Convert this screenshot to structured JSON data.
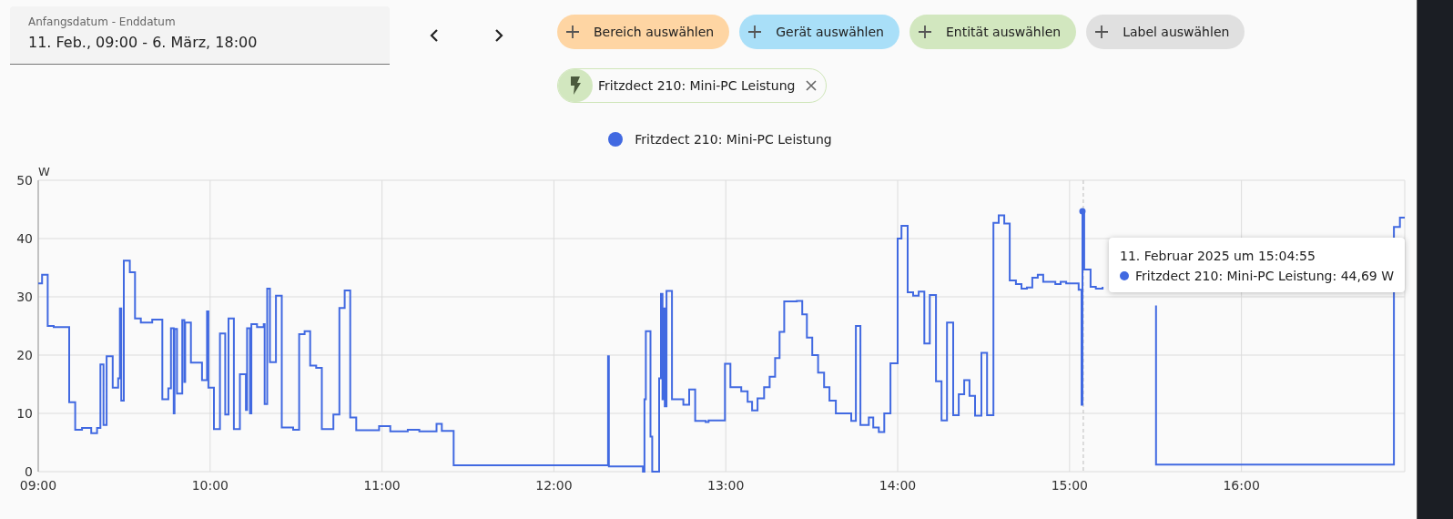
{
  "date_range": {
    "label": "Anfangsdatum - Enddatum",
    "value": "11. Feb., 09:00 - 6. März, 18:00"
  },
  "nav": [
    {
      "kind": "prev"
    },
    {
      "kind": "next"
    }
  ],
  "filters": [
    {
      "label": "Bereich auswählen",
      "color": "#fed5a3"
    },
    {
      "label": "Gerät auswählen",
      "color": "#a9dff8"
    },
    {
      "label": "Entität auswählen",
      "color": "#d2e7bf"
    },
    {
      "label": "Label auswählen",
      "color": "#e0e0e0"
    }
  ],
  "selected_entities": [
    {
      "label": "Fritzdect 210: Mini-PC Leistung",
      "kind": "power"
    }
  ],
  "chart": {
    "chart_data": {
      "type": "line",
      "grid": true,
      "ylabel": "W",
      "xlim": [
        9,
        16.95
      ],
      "ylim": [
        0,
        50
      ],
      "xticks": [
        {
          "value": 9,
          "label": "09:00"
        },
        {
          "value": 10,
          "label": "10:00"
        },
        {
          "value": 11,
          "label": "11:00"
        },
        {
          "value": 12,
          "label": "12:00"
        },
        {
          "value": 13,
          "label": "13:00"
        },
        {
          "value": 14,
          "label": "14:00"
        },
        {
          "value": 15,
          "label": "15:00"
        },
        {
          "value": 16,
          "label": "16:00"
        }
      ],
      "yticks": [
        0,
        10,
        20,
        30,
        40,
        50
      ],
      "ref_lines": [
        {
          "axis": "x",
          "value": 15.08
        }
      ],
      "x": [
        9,
        9.022,
        9.022,
        9.055,
        9.055,
        9.09,
        9.09,
        9.18,
        9.18,
        9.215,
        9.215,
        9.255,
        9.255,
        9.308,
        9.308,
        9.342,
        9.342,
        9.362,
        9.362,
        9.38,
        9.38,
        9.398,
        9.398,
        9.433,
        9.433,
        9.465,
        9.465,
        9.475,
        9.475,
        9.483,
        9.483,
        9.498,
        9.498,
        9.533,
        9.533,
        9.563,
        9.563,
        9.597,
        9.597,
        9.663,
        9.663,
        9.722,
        9.722,
        9.757,
        9.757,
        9.772,
        9.772,
        9.788,
        9.788,
        9.793,
        9.793,
        9.807,
        9.807,
        9.838,
        9.838,
        9.85,
        9.85,
        9.855,
        9.855,
        9.888,
        9.888,
        9.953,
        9.953,
        9.982,
        9.982,
        9.99,
        9.99,
        10.022,
        10.022,
        10.057,
        10.057,
        10.088,
        10.088,
        10.107,
        10.107,
        10.138,
        10.138,
        10.173,
        10.173,
        10.208,
        10.208,
        10.215,
        10.215,
        10.232,
        10.232,
        10.24,
        10.24,
        10.273,
        10.273,
        10.312,
        10.312,
        10.317,
        10.317,
        10.332,
        10.332,
        10.348,
        10.348,
        10.383,
        10.383,
        10.417,
        10.417,
        10.483,
        10.483,
        10.518,
        10.518,
        10.55,
        10.55,
        10.582,
        10.582,
        10.617,
        10.617,
        10.65,
        10.65,
        10.717,
        10.717,
        10.752,
        10.752,
        10.783,
        10.783,
        10.815,
        10.815,
        10.85,
        10.85,
        10.983,
        10.983,
        11.048,
        11.048,
        11.15,
        11.15,
        11.217,
        11.217,
        11.317,
        11.317,
        11.348,
        11.348,
        11.417,
        11.417,
        12.315,
        12.315,
        12.32,
        12.32,
        12.518,
        12.518,
        12.527,
        12.527,
        12.535,
        12.535,
        12.562,
        12.562,
        12.572,
        12.572,
        12.612,
        12.612,
        12.623,
        12.623,
        12.632,
        12.632,
        12.638,
        12.638,
        12.645,
        12.645,
        12.655,
        12.655,
        12.687,
        12.687,
        12.753,
        12.753,
        12.787,
        12.787,
        12.822,
        12.822,
        12.883,
        12.883,
        12.9,
        12.9,
        12.995,
        12.995,
        13.027,
        13.027,
        13.09,
        13.09,
        13.127,
        13.127,
        13.153,
        13.153,
        13.185,
        13.185,
        13.223,
        13.223,
        13.255,
        13.255,
        13.287,
        13.287,
        13.313,
        13.313,
        13.34,
        13.34,
        13.413,
        13.413,
        13.445,
        13.445,
        13.472,
        13.472,
        13.503,
        13.503,
        13.537,
        13.537,
        13.572,
        13.572,
        13.603,
        13.603,
        13.64,
        13.64,
        13.73,
        13.73,
        13.757,
        13.757,
        13.783,
        13.783,
        13.832,
        13.832,
        13.858,
        13.858,
        13.89,
        13.89,
        13.922,
        13.922,
        13.958,
        13.958,
        14,
        14,
        14.022,
        14.022,
        14.058,
        14.058,
        14.09,
        14.09,
        14.122,
        14.122,
        14.155,
        14.155,
        14.187,
        14.187,
        14.223,
        14.223,
        14.255,
        14.255,
        14.287,
        14.287,
        14.323,
        14.323,
        14.355,
        14.355,
        14.387,
        14.387,
        14.418,
        14.418,
        14.45,
        14.45,
        14.487,
        14.487,
        14.52,
        14.52,
        14.557,
        14.557,
        14.588,
        14.588,
        14.62,
        14.62,
        14.652,
        14.652,
        14.688,
        14.688,
        14.72,
        14.72,
        14.752,
        14.752,
        14.783,
        14.783,
        14.815,
        14.815,
        14.847,
        14.847,
        14.917,
        14.917,
        14.948,
        14.948,
        14.98,
        14.98,
        15.053,
        15.053,
        15.07,
        15.07,
        15.075,
        15.075,
        15.085,
        15.085,
        15.122,
        15.122,
        15.153,
        15.153,
        15.192,
        15.192,
        15.25,
        15.503,
        15.503,
        16.887,
        16.887,
        16.922,
        16.922,
        16.95
      ],
      "series": [
        {
          "name": "Fritzdect 210: Mini-PC Leistung",
          "color": "#4169e1",
          "values": [
            32.3,
            32.3,
            33.8,
            33.8,
            25,
            25,
            24.8,
            24.8,
            11.9,
            11.9,
            7.2,
            7.2,
            7.5,
            7.5,
            6.6,
            6.6,
            7.5,
            7.5,
            18.4,
            18.4,
            8,
            8,
            19.8,
            19.8,
            14.4,
            14.4,
            16,
            16,
            28,
            28,
            12.2,
            12.2,
            36.2,
            36.2,
            34.2,
            34.2,
            26.3,
            26.3,
            25.6,
            25.6,
            26.1,
            26.1,
            12.4,
            12.4,
            14.3,
            14.3,
            24.6,
            24.6,
            10,
            10,
            24.5,
            24.5,
            13.4,
            13.4,
            26,
            26,
            15.4,
            15.4,
            25.6,
            25.6,
            18.7,
            18.7,
            15.7,
            15.7,
            27.5,
            27.5,
            14.4,
            14.4,
            7.3,
            7.3,
            23.7,
            23.7,
            9.8,
            9.8,
            26.3,
            26.3,
            7.3,
            7.3,
            16.7,
            16.7,
            10.6,
            10.6,
            24.6,
            24.6,
            10,
            10,
            25.3,
            25.3,
            24.8,
            24.8,
            25.3,
            25.3,
            11.6,
            11.6,
            31.4,
            31.4,
            18.8,
            18.8,
            30.2,
            30.2,
            7.6,
            7.6,
            7.2,
            7.2,
            23.6,
            23.6,
            24.1,
            24.1,
            18.2,
            18.2,
            17.8,
            17.8,
            7.3,
            7.3,
            9.8,
            9.8,
            28.1,
            28.1,
            31.1,
            31.1,
            9.3,
            9.3,
            7.1,
            7.1,
            7.8,
            7.8,
            6.9,
            6.9,
            7.2,
            7.2,
            6.9,
            6.9,
            8.2,
            8.2,
            7,
            7,
            1.1,
            1.1,
            19.8,
            19.8,
            0.9,
            0.9,
            0,
            0,
            12.4,
            12.4,
            24.1,
            24.1,
            6,
            6,
            0,
            0,
            16,
            16,
            30.5,
            30.5,
            12.4,
            12.4,
            28,
            28,
            11.2,
            11.2,
            31,
            31,
            12.4,
            12.4,
            11.5,
            11.5,
            14.1,
            14.1,
            8.7,
            8.7,
            8.5,
            8.5,
            8.8,
            8.8,
            18.5,
            18.5,
            14.5,
            14.5,
            13.8,
            13.8,
            12,
            12,
            10.5,
            10.5,
            12.6,
            12.6,
            14.5,
            14.5,
            16.3,
            16.3,
            19.5,
            19.5,
            24,
            24,
            29.2,
            29.2,
            29.3,
            29.3,
            27,
            27,
            23,
            23,
            20,
            20,
            17,
            17,
            14.5,
            14.5,
            12.2,
            12.2,
            10,
            10,
            8.7,
            8.7,
            25,
            25,
            8,
            8,
            9.3,
            9.3,
            7.6,
            7.6,
            6.8,
            6.8,
            10,
            10,
            18.6,
            18.6,
            40,
            40,
            42.2,
            42.2,
            30.8,
            30.8,
            30.2,
            30.2,
            30.9,
            30.9,
            22,
            22,
            30.3,
            30.3,
            15.5,
            15.5,
            8.8,
            8.8,
            25.6,
            25.6,
            9.7,
            9.7,
            13.3,
            13.3,
            15.7,
            15.7,
            13,
            13,
            9.6,
            9.6,
            20.4,
            20.4,
            9.7,
            9.7,
            42.7,
            42.7,
            44,
            44,
            42.6,
            42.6,
            32.8,
            32.8,
            32.2,
            32.2,
            31.4,
            31.4,
            31.6,
            31.6,
            33.3,
            33.3,
            33.8,
            33.8,
            32.6,
            32.6,
            32.2,
            32.2,
            32.6,
            32.6,
            32.3,
            32.3,
            31.2,
            31.2,
            11.5,
            11.5,
            44.69,
            44.69,
            34.7,
            34.7,
            31.7,
            31.7,
            31.4,
            31.4,
            31.7,
            null,
            28.5,
            1.2,
            1.2,
            42,
            42,
            43.6,
            43.6
          ]
        }
      ]
    },
    "tooltip": {
      "title": "11. Februar 2025 um 15:04:55",
      "label": "Fritzdect 210: Mini-PC Leistung: 44,69 W"
    }
  }
}
